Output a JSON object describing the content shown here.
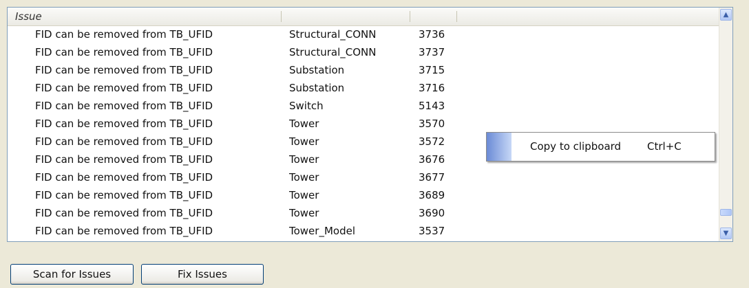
{
  "listview": {
    "columns": [
      {
        "label": "Issue"
      },
      {
        "label": ""
      },
      {
        "label": ""
      }
    ],
    "rows": [
      [
        "FID can be removed from TB_UFID",
        "Structural_CONN",
        "3736"
      ],
      [
        "FID can be removed from TB_UFID",
        "Structural_CONN",
        "3737"
      ],
      [
        "FID can be removed from TB_UFID",
        "Substation",
        "3715"
      ],
      [
        "FID can be removed from TB_UFID",
        "Substation",
        "3716"
      ],
      [
        "FID can be removed from TB_UFID",
        "Switch",
        "5143"
      ],
      [
        "FID can be removed from TB_UFID",
        "Tower",
        "3570"
      ],
      [
        "FID can be removed from TB_UFID",
        "Tower",
        "3572"
      ],
      [
        "FID can be removed from TB_UFID",
        "Tower",
        "3676"
      ],
      [
        "FID can be removed from TB_UFID",
        "Tower",
        "3677"
      ],
      [
        "FID can be removed from TB_UFID",
        "Tower",
        "3689"
      ],
      [
        "FID can be removed from TB_UFID",
        "Tower",
        "3690"
      ],
      [
        "FID can be removed from TB_UFID",
        "Tower_Model",
        "3537"
      ]
    ]
  },
  "context_menu": {
    "items": [
      {
        "label": "Copy to clipboard",
        "shortcut": "Ctrl+C"
      }
    ]
  },
  "buttons": {
    "scan": "Scan for Issues",
    "fix": "Fix Issues"
  },
  "icons": {
    "scroll_up": "chevron-up-icon",
    "scroll_down": "chevron-down-icon"
  },
  "colors": {
    "window_bg": "#ece9d8",
    "list_border": "#7f9db9",
    "button_border": "#003c74",
    "menu_gutter": "#6b8bd6"
  }
}
